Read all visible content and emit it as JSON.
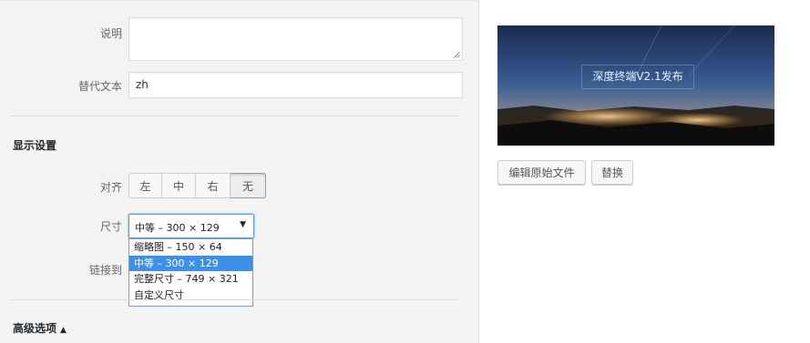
{
  "caption": {
    "label": "说明",
    "value": ""
  },
  "alt_text": {
    "label": "替代文本",
    "value": "zh"
  },
  "display_settings": {
    "heading": "显示设置",
    "align": {
      "label": "对齐",
      "options": [
        "左",
        "中",
        "右",
        "无"
      ],
      "selected": "无"
    },
    "size": {
      "label": "尺寸",
      "selected_value": "中等 – 300 × 129",
      "options": [
        "缩略图 – 150 × 64",
        "中等 – 300 × 129",
        "完整尺寸 – 749 × 321",
        "自定义尺寸"
      ],
      "highlighted": "中等 – 300 × 129"
    },
    "link_to": {
      "label": "链接到"
    }
  },
  "advanced": {
    "label": "高级选项",
    "toggle_icon": "triangle-up-icon"
  },
  "preview": {
    "overlay_text": "深度终端V2.1发布"
  },
  "actions": {
    "edit_original": "编辑原始文件",
    "replace": "替换"
  },
  "colors": {
    "panel_bg": "#f3f3f3",
    "selected_option": "#3d8fe8",
    "focus_border": "#5b9dd9"
  }
}
